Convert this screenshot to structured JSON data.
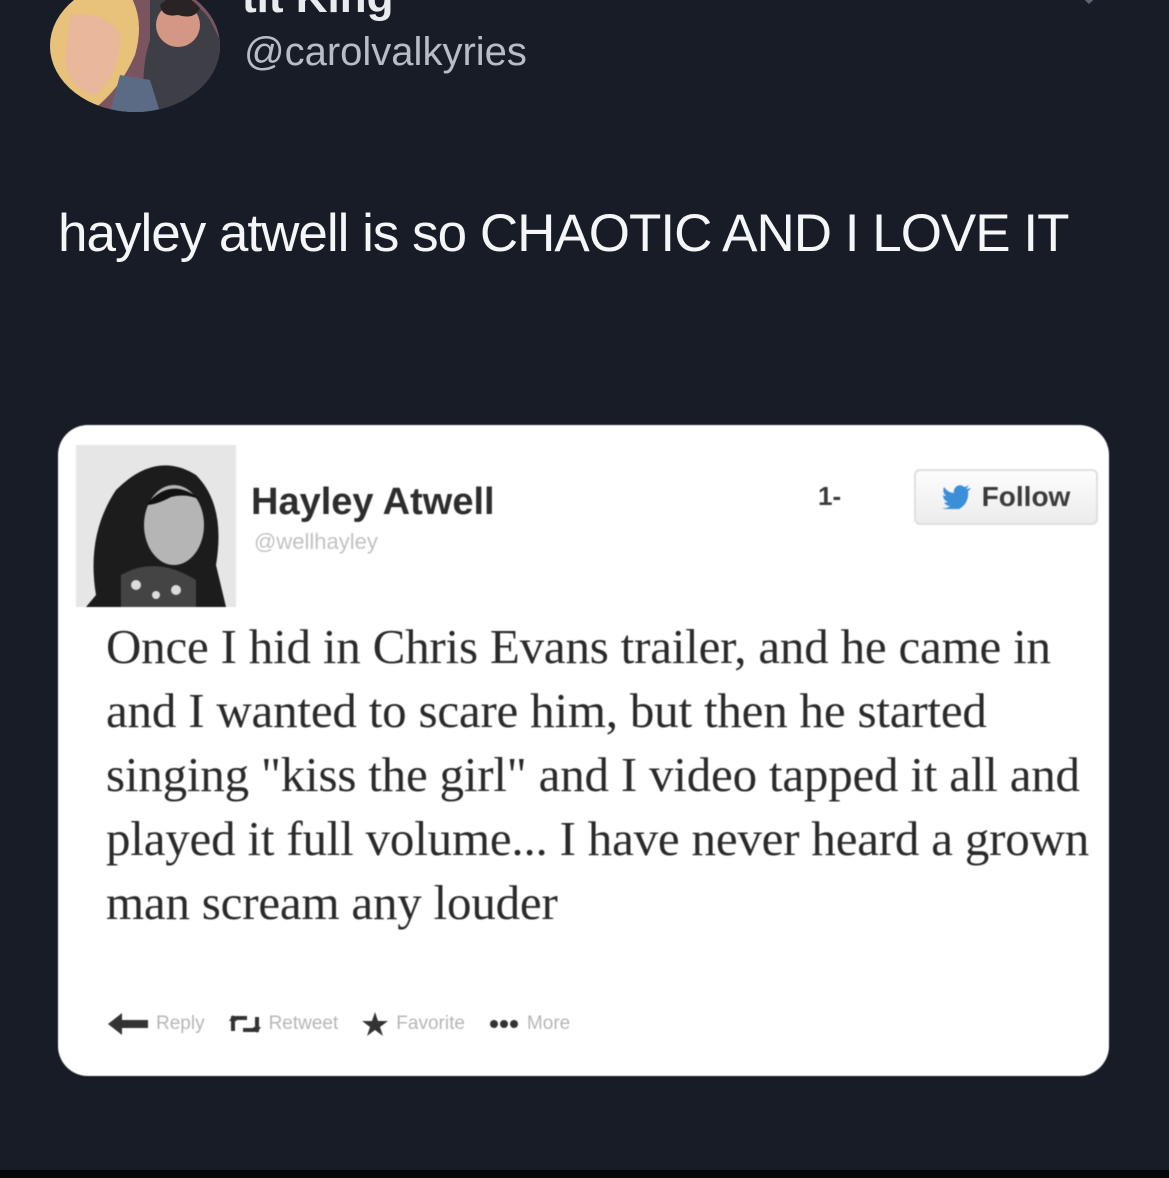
{
  "tweet": {
    "display_name": "tit King",
    "handle": "@carolvalkyries",
    "text": "hayley atwell is so CHAOTIC AND I LOVE IT",
    "avatar_icon": "comic-avatar",
    "menu_icon": "chevron-down-icon"
  },
  "embedded_tweet": {
    "name": "Hayley Atwell",
    "handle": "@wellhayley",
    "user_menu_label": "1-",
    "follow_label": "Follow",
    "follow_icon": "twitter-bird-icon",
    "body": "Once I hid in Chris Evans trailer, and he came in and I wanted to scare him, but then he started singing \"kiss the girl\" and I video tapped it all and played it full volume... I have never heard a grown man scream any louder",
    "actions": [
      {
        "label": "Reply",
        "icon": "reply-arrow-icon"
      },
      {
        "label": "Retweet",
        "icon": "retweet-icon"
      },
      {
        "label": "Favorite",
        "icon": "star-icon"
      },
      {
        "label": "More",
        "icon": "more-dots-icon"
      }
    ]
  },
  "colors": {
    "background": "#171c26",
    "text_primary": "#f5f6f7",
    "text_secondary": "#b7bdc5",
    "card": "#ffffff"
  }
}
